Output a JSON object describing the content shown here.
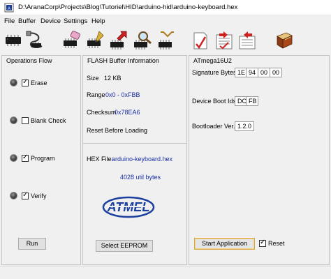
{
  "window": {
    "title": "D:\\AranaCorp\\Projects\\Blog\\Tutoriel\\HID\\arduino-hid\\arduino-keyboard.hex"
  },
  "menu": [
    "File",
    "Buffer",
    "Device",
    "Settings",
    "Help"
  ],
  "toolbar": [
    {
      "icon": "select-device-chip-icon"
    },
    {
      "icon": "usb-communication-icon"
    },
    {
      "icon": "erase-device-icon"
    },
    {
      "icon": "program-device-icon"
    },
    {
      "icon": "read-device-icon"
    },
    {
      "icon": "verify-device-icon"
    },
    {
      "icon": "load-hex-file-icon"
    },
    {
      "icon": "save-buffer-icon"
    },
    {
      "icon": "edit-buffer-icon"
    },
    {
      "icon": "help-book-icon"
    }
  ],
  "operations": {
    "title": "Operations Flow",
    "items": [
      {
        "label": "Erase",
        "checked": true
      },
      {
        "label": "Blank Check",
        "checked": false
      },
      {
        "label": "Program",
        "checked": true
      },
      {
        "label": "Verify",
        "checked": true
      }
    ],
    "run_label": "Run"
  },
  "flash": {
    "title": "FLASH Buffer Information",
    "size_label": "Size",
    "size_value": "12 KB",
    "range_label": "Range",
    "range_value": "0x0 - 0xFBB",
    "checksum_label": "Checksum",
    "checksum_value": "0x78EA6",
    "reset_label": "Reset Before Loading",
    "hex_label": "HEX File:",
    "hex_value": "arduino-keyboard.hex",
    "bytes_value": "4028 util bytes",
    "logo_text": "ATMEL",
    "select_eeprom_label": "Select EEPROM"
  },
  "device": {
    "title": "ATmega16U2",
    "signature_label": "Signature Bytes",
    "signature_values": [
      "1E",
      "94",
      "00",
      "00"
    ],
    "boot_ids_label": "Device Boot Ids",
    "boot_ids_values": [
      "DC",
      "FB"
    ],
    "bootloader_label": "Bootloader Ver.",
    "bootloader_value": "1.2.0",
    "start_app_label": "Start Application",
    "reset_label": "Reset",
    "reset_checked": true
  },
  "colors": {
    "value_blue": "#1a2ea8",
    "atmel_blue": "#1a3f9e"
  }
}
